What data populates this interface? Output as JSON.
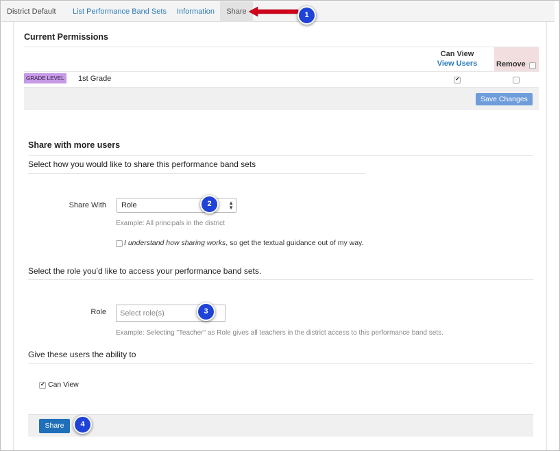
{
  "tabs": [
    {
      "label": "District Default"
    },
    {
      "label": "List Performance Band Sets"
    },
    {
      "label": "Information"
    },
    {
      "label": "Share"
    }
  ],
  "permissions": {
    "title": "Current Permissions",
    "col_can_view": "Can View",
    "col_view_users": "View Users",
    "col_remove": "Remove",
    "rows": [
      {
        "badge": "GRADE LEVEL",
        "name": "1st Grade",
        "can_view": true,
        "remove": false
      }
    ],
    "save_label": "Save Changes"
  },
  "share": {
    "title": "Share with more users",
    "subtitle": "Select how you would like to share this performance band sets",
    "share_with_label": "Share With",
    "share_with_value": "Role",
    "share_with_help": "Example: All principals in the district",
    "understand_italic": "I understand how sharing works",
    "understand_rest": ", so get the textual guidance out of my way.",
    "role_section_title": "Select the role you’d like to access your performance band sets.",
    "role_label": "Role",
    "role_placeholder": "Select role(s)",
    "role_help": "Example: Selecting \"Teacher\" as Role gives all teachers in the district access to this performance band sets.",
    "ability_title": "Give these users the ability to",
    "can_view_label": "Can View",
    "share_button": "Share"
  },
  "callouts": [
    "1",
    "2",
    "3",
    "4"
  ],
  "colors": {
    "link": "#2a7ab8",
    "callout": "#1f43d6",
    "arrow": "#d0021b",
    "badge": "#c79ae6",
    "remove_header": "#f2dede",
    "save_button": "#6f9ddb",
    "share_button": "#1f6fb9"
  }
}
